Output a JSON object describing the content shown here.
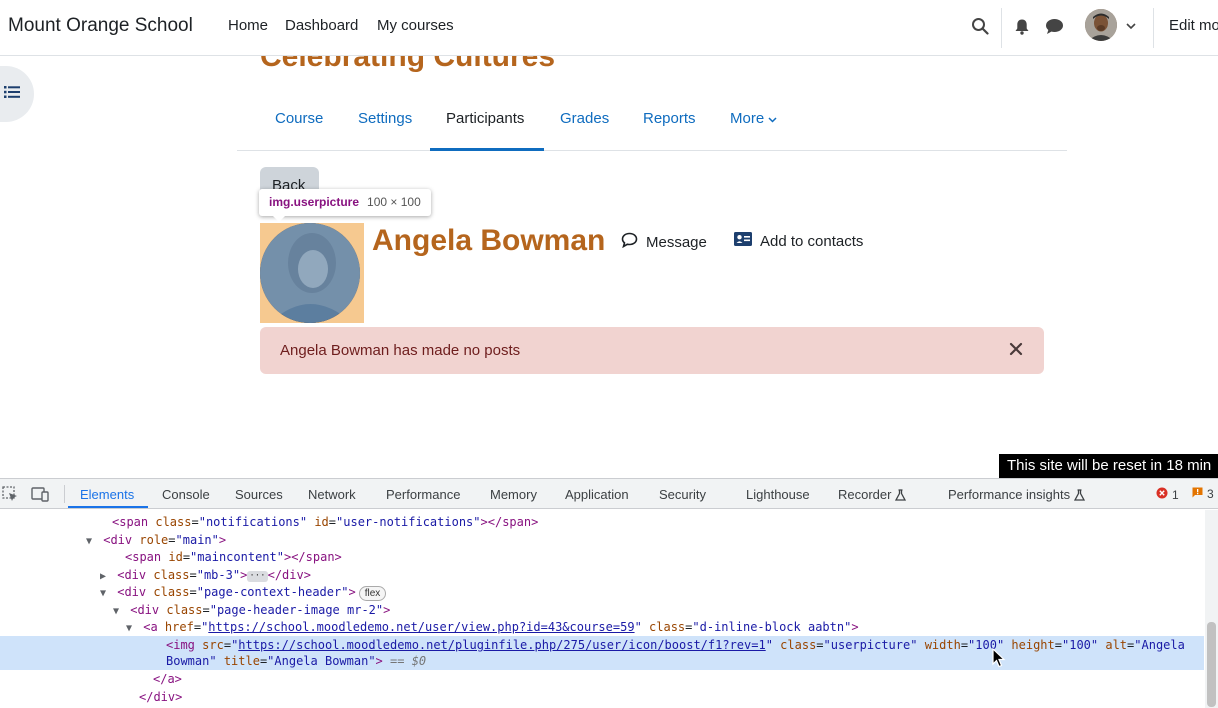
{
  "navbar": {
    "brand": "Mount Orange School",
    "links": [
      "Home",
      "Dashboard",
      "My courses"
    ],
    "edit_mode": "Edit mo"
  },
  "course": {
    "title": "Celebrating Cultures",
    "tabs": [
      "Course",
      "Settings",
      "Participants",
      "Grades",
      "Reports",
      "More"
    ],
    "active_tab": "Participants"
  },
  "back_button": "Back",
  "tooltip": {
    "selector": "img.userpicture",
    "size": "100 × 100"
  },
  "profile": {
    "name": "Angela Bowman",
    "message": "Message",
    "add_contact": "Add to contacts"
  },
  "alert": {
    "text": "Angela Bowman has made no posts"
  },
  "reset_notice": "This site will be reset in 18 min",
  "devtools": {
    "tabs": [
      "Elements",
      "Console",
      "Sources",
      "Network",
      "Performance",
      "Memory",
      "Application",
      "Security",
      "Lighthouse",
      "Recorder",
      "Performance insights"
    ],
    "active_tab": "Elements",
    "error_count": "1",
    "warning_count": "3",
    "flex_badge": "flex",
    "dom": {
      "l1": {
        "tag": "span",
        "attrs": [
          [
            "class",
            "notifications"
          ],
          [
            "id",
            "user-notifications"
          ]
        ],
        "close": "</span>"
      },
      "l2": {
        "tag": "div",
        "attrs": [
          [
            "role",
            "main"
          ]
        ]
      },
      "l3": {
        "tag": "span",
        "attrs": [
          [
            "id",
            "maincontent"
          ]
        ],
        "close": "</span>"
      },
      "l4": {
        "tag": "div",
        "attrs": [
          [
            "class",
            "mb-3"
          ]
        ],
        "close": "</div>"
      },
      "l5": {
        "tag": "div",
        "attrs": [
          [
            "class",
            "page-context-header"
          ]
        ]
      },
      "l6": {
        "tag": "div",
        "attrs": [
          [
            "class",
            "page-header-image mr-2"
          ]
        ]
      },
      "l7": {
        "tag": "a",
        "href": "https://school.moodledemo.net/user/view.php?id=43&course=59",
        "class_val": "d-inline-block aabtn"
      },
      "l8": {
        "tag": "img",
        "src": "https://school.moodledemo.net/pluginfile.php/275/user/icon/boost/f1?rev=1",
        "class_val": "userpicture",
        "width": "100",
        "height": "100",
        "alt_start": "Angela",
        "alt_end": "Bowman",
        "title": "Angela Bowman",
        "eq": "== $0"
      },
      "l9": "</a>",
      "l10": "</div>"
    }
  },
  "colors": {
    "brand_orange": "#b5651d",
    "link_blue": "#0f6cbf",
    "alert_bg": "#f1d3d0",
    "devtools_accent": "#1a73e8"
  }
}
